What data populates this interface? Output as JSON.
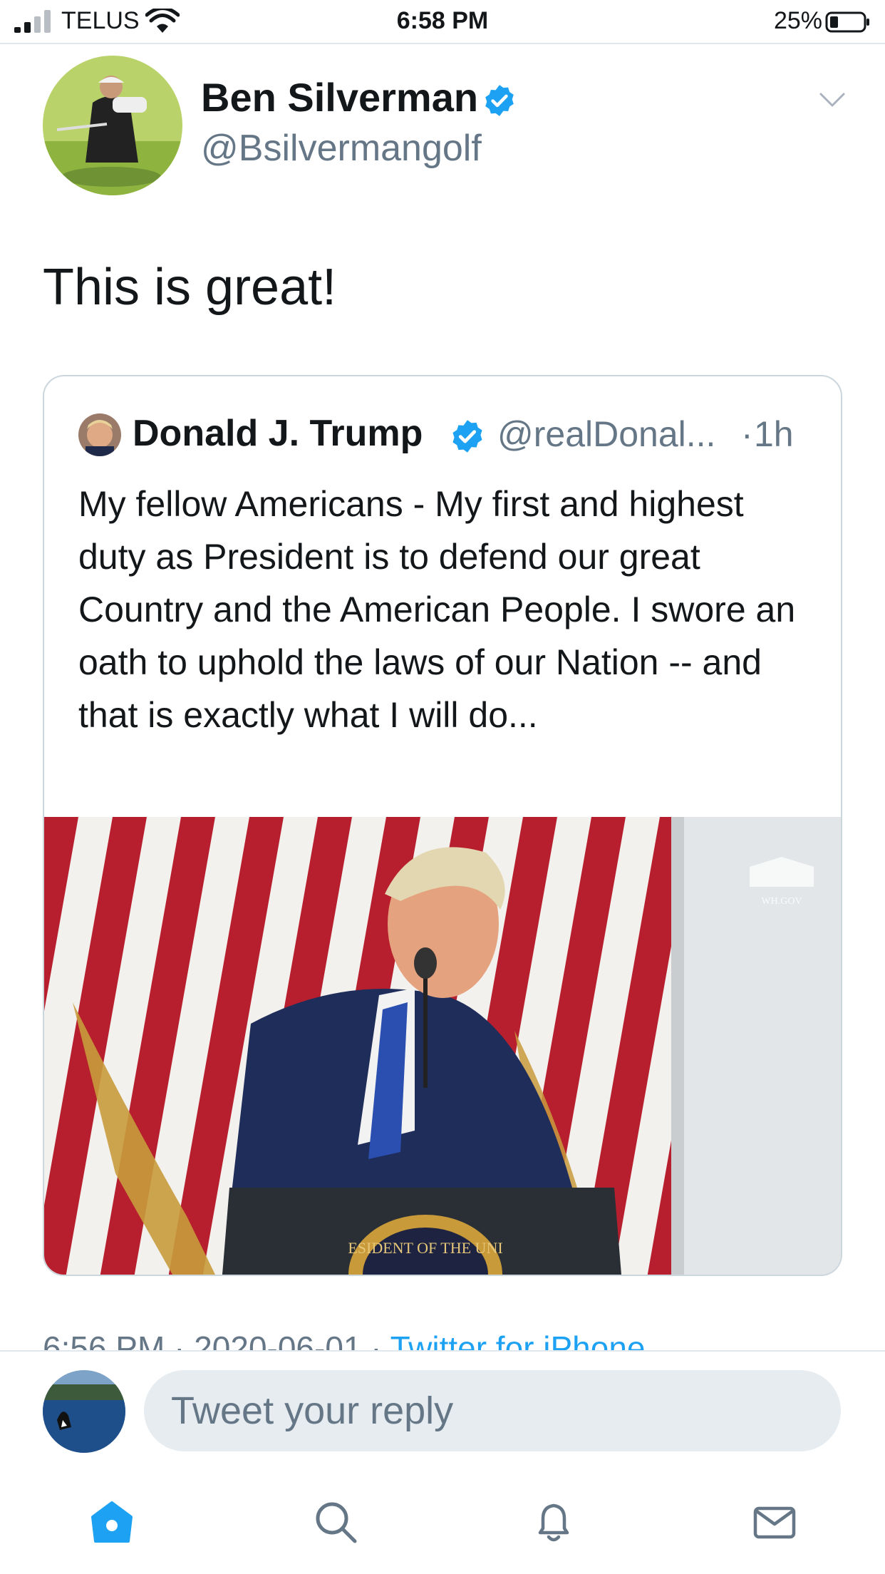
{
  "status_bar": {
    "carrier": "TELUS",
    "time": "6:58 PM",
    "battery": "25%"
  },
  "tweet": {
    "author_name": "Ben Silverman",
    "author_handle": "@Bsilvermangolf",
    "text": "This is great!",
    "timestamp": "6:56 PM · 2020-06-01",
    "source": "Twitter for iPhone"
  },
  "quoted_tweet": {
    "author_name": "Donald J. Trump",
    "author_handle": "@realDonal...",
    "separator": "·",
    "time": "1h",
    "text": "My fellow Americans - My first and highest duty as President is to defend our great Country and the American People. I swore an oath to uphold the laws of our Nation -- and that is exactly what I will do...",
    "media_watermark": "WH.GOV",
    "seal_text": "ESIDENT OF THE UNI"
  },
  "reply": {
    "placeholder": "Tweet your reply"
  },
  "tab_bar": [
    "home-icon",
    "search-icon",
    "notifications-icon",
    "messages-icon"
  ],
  "colors": {
    "accent": "#1da1f2",
    "secondary_text": "#657786",
    "reply_field": "#e6ecf0",
    "border": "#e1e8ed"
  }
}
